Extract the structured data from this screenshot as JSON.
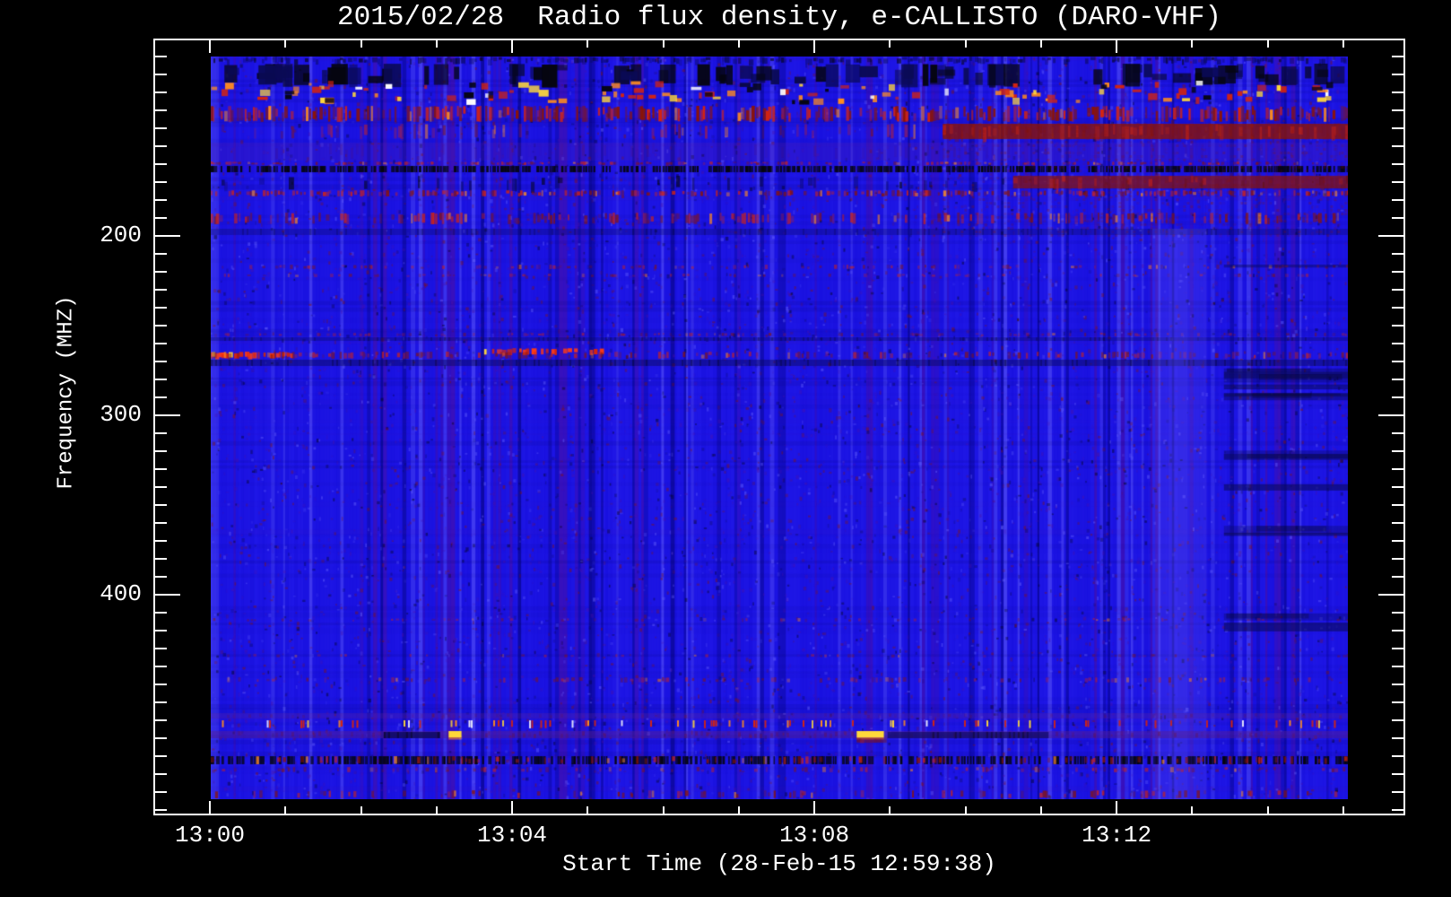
{
  "page": {
    "background": "#000000"
  },
  "chart_data": {
    "type": "heatmap",
    "title": "2015/02/28  Radio flux density, e-CALLISTO (DARO-VHF)",
    "xlabel": "Start Time (28-Feb-15 12:59:38)",
    "ylabel": "Frequency (MHZ)",
    "legend": "none",
    "grid": "off",
    "x_axis": {
      "unit": "minutes after 13:00",
      "frame_range": [
        -0.74,
        15.82
      ],
      "data_range": [
        0.012,
        15.06
      ],
      "major_ticks": [
        {
          "t": 0,
          "label": "13:00"
        },
        {
          "t": 4,
          "label": "13:04"
        },
        {
          "t": 8,
          "label": "13:08"
        },
        {
          "t": 12,
          "label": "13:12"
        }
      ],
      "minor_ticks": [
        1,
        2,
        3,
        5,
        6,
        7,
        9,
        10,
        11,
        13,
        14,
        15
      ]
    },
    "y_axis": {
      "unit": "MHz",
      "direction": "increasing-downward",
      "frame_range": [
        91,
        523.5
      ],
      "data_range": [
        100,
        514
      ],
      "major_ticks": [
        {
          "f": 200,
          "label": "200"
        },
        {
          "f": 300,
          "label": "300"
        },
        {
          "f": 400,
          "label": "400"
        }
      ],
      "minor_tick_step": 10,
      "minor_tick_span": [
        100,
        520
      ]
    },
    "palette": {
      "base": "#1a12e0",
      "base2": "#2b22f5",
      "stripe_purple": "#4a10a8",
      "stripe_light": "#6a66ff",
      "stripe_dark": "#000060",
      "navy": "#0a0a55",
      "black": "#050510",
      "red": "#d42410",
      "red_bright": "#ff3c14",
      "red_dark": "#8c1405",
      "maroon": "#6e1030",
      "orange": "#ff8c1e",
      "yellow": "#ffd83a",
      "white": "#ffffff",
      "purple": "#5a2090",
      "lilac": "#8878ff",
      "frame": "#ffffff",
      "text": "#ffffff",
      "background": "#000000"
    },
    "noise": {
      "stripes": true,
      "fine_grain": 9000,
      "row_mottle": true
    },
    "bands": [
      {
        "kind": "dark_speckle",
        "f": [
          100,
          103.5
        ],
        "density": 0.45
      },
      {
        "kind": "black_patches",
        "f": [
          104,
          116
        ],
        "density": 0.5
      },
      {
        "kind": "bright_mix",
        "f": [
          113.5,
          127
        ],
        "density": 0.5
      },
      {
        "kind": "red_speckle",
        "f": [
          127.5,
          136.5
        ],
        "density": 0.7,
        "strength": 1
      },
      {
        "kind": "red_speckle",
        "f": [
          137.5,
          146
        ],
        "density": 0.18,
        "strength": 0.55
      },
      {
        "kind": "red_fill",
        "f": [
          137.5,
          146
        ],
        "t": [
          9.7,
          15.06
        ],
        "alpha": 0.8
      },
      {
        "kind": "purple_wash",
        "f": [
          148,
          158
        ],
        "alpha": 0.2
      },
      {
        "kind": "red_speckle",
        "f": [
          158.5,
          160.5
        ],
        "density": 0.45,
        "strength": 0.7
      },
      {
        "kind": "black_dashes",
        "f": [
          161,
          164.5
        ],
        "density": 0.75
      },
      {
        "kind": "dark_speckle",
        "f": [
          166.5,
          173.5
        ],
        "density": 0.1
      },
      {
        "kind": "red_fill",
        "f": [
          166.5,
          173.5
        ],
        "t": [
          10.63,
          15.06
        ],
        "alpha": 0.7
      },
      {
        "kind": "red_speckle",
        "f": [
          174.5,
          178
        ],
        "density": 0.65,
        "strength": 0.85
      },
      {
        "kind": "red_speckle",
        "f": [
          187,
          193.5
        ],
        "density": 0.5,
        "strength": 0.75
      },
      {
        "kind": "navy_fill",
        "f": [
          196,
          199.5
        ],
        "alpha": 0.3
      },
      {
        "kind": "red_mottle",
        "f": [
          137,
          201
        ],
        "t": [
          9.7,
          15.06
        ],
        "alpha": 0.14
      },
      {
        "kind": "red_speckle",
        "f": [
          216,
          218.5
        ],
        "density": 0.28,
        "strength": 0.55
      },
      {
        "kind": "red_speckle",
        "f": [
          221,
          223
        ],
        "density": 0.22,
        "strength": 0.5
      },
      {
        "kind": "red_speckle",
        "f": [
          254,
          256
        ],
        "density": 0.3,
        "strength": 0.5
      },
      {
        "kind": "navy_fill",
        "f": [
          256.5,
          258.5
        ],
        "alpha": 0.35
      },
      {
        "kind": "red_streak",
        "f": [
          262.5,
          266
        ],
        "t": [
          3.63,
          5.2
        ]
      },
      {
        "kind": "red_streak",
        "f": [
          264.5,
          268
        ],
        "t": [
          0.02,
          1.1
        ]
      },
      {
        "kind": "red_speckle",
        "f": [
          264.5,
          268.5
        ],
        "density": 0.45,
        "strength": 0.7
      },
      {
        "kind": "navy_fill",
        "f": [
          269,
          272.5
        ],
        "alpha": 0.45
      },
      {
        "kind": "light_column",
        "f": [
          196,
          514
        ],
        "t": [
          12.47,
          13.19
        ],
        "alpha": 0.16
      },
      {
        "kind": "dark_rows",
        "f": [
          205,
          462
        ],
        "t": [
          13.42,
          15.06
        ],
        "rows": 14
      },
      {
        "kind": "red_speckle",
        "f": [
          413,
          415
        ],
        "density": 0.14,
        "strength": 0.45
      },
      {
        "kind": "red_speckle",
        "f": [
          433,
          435
        ],
        "density": 0.14,
        "strength": 0.45
      },
      {
        "kind": "red_speckle",
        "f": [
          446,
          449
        ],
        "density": 0.28,
        "strength": 0.55
      },
      {
        "kind": "purple_wash",
        "f": [
          466,
          469
        ],
        "alpha": 0.3
      },
      {
        "kind": "dash_row",
        "f": [
          470,
          474.5
        ],
        "density": 0.16
      },
      {
        "kind": "purple_wash",
        "f": [
          476,
          480
        ],
        "alpha": 0.45
      },
      {
        "kind": "navy_fill",
        "f": [
          476.5,
          480
        ],
        "t": [
          2.3,
          3.05
        ],
        "alpha": 0.75
      },
      {
        "kind": "navy_fill",
        "f": [
          476.5,
          480
        ],
        "t": [
          8.97,
          11.1
        ],
        "alpha": 0.6
      },
      {
        "kind": "yellow_blob",
        "f": [
          476,
          479.5
        ],
        "t": [
          3.16,
          3.33
        ]
      },
      {
        "kind": "yellow_blob",
        "f": [
          476,
          479.5
        ],
        "t": [
          8.56,
          8.92
        ]
      },
      {
        "kind": "red_fill",
        "f": [
          480,
          482.5
        ],
        "t": [
          8.56,
          8.92
        ],
        "alpha": 0.45
      },
      {
        "kind": "black_dashes",
        "f": [
          490,
          494.5
        ],
        "density": 0.65
      },
      {
        "kind": "red_speckle",
        "f": [
          490,
          494.5
        ],
        "density": 0.3,
        "strength": 0.8
      },
      {
        "kind": "red_speckle",
        "f": [
          496,
          499
        ],
        "density": 0.3,
        "strength": 0.6
      },
      {
        "kind": "red_speckle",
        "f": [
          509,
          513.5
        ],
        "density": 0.22,
        "strength": 0.8
      }
    ]
  }
}
